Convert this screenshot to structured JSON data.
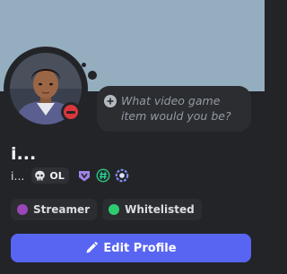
{
  "profile": {
    "display_name": "i...",
    "username": "i...",
    "status": "do-not-disturb"
  },
  "custom_status": {
    "placeholder": "What video game item would you be?"
  },
  "clan_tag": {
    "label": "OL",
    "icon": "skull-icon"
  },
  "badges": [
    {
      "name": "nitro-badge",
      "color": "#a083e6"
    },
    {
      "name": "hashtag-badge",
      "color": "#2fbf71"
    },
    {
      "name": "quest-badge",
      "color": "#7f8ff4"
    }
  ],
  "roles": [
    {
      "label": "Streamer",
      "color": "#9a46b8"
    },
    {
      "label": "Whitelisted",
      "color": "#2ecc71"
    }
  ],
  "actions": {
    "edit_profile_label": "Edit Profile"
  },
  "colors": {
    "banner": "#94aebf",
    "card_background": "#232428",
    "accent": "#5865f2",
    "dnd_status": "#da373c"
  }
}
